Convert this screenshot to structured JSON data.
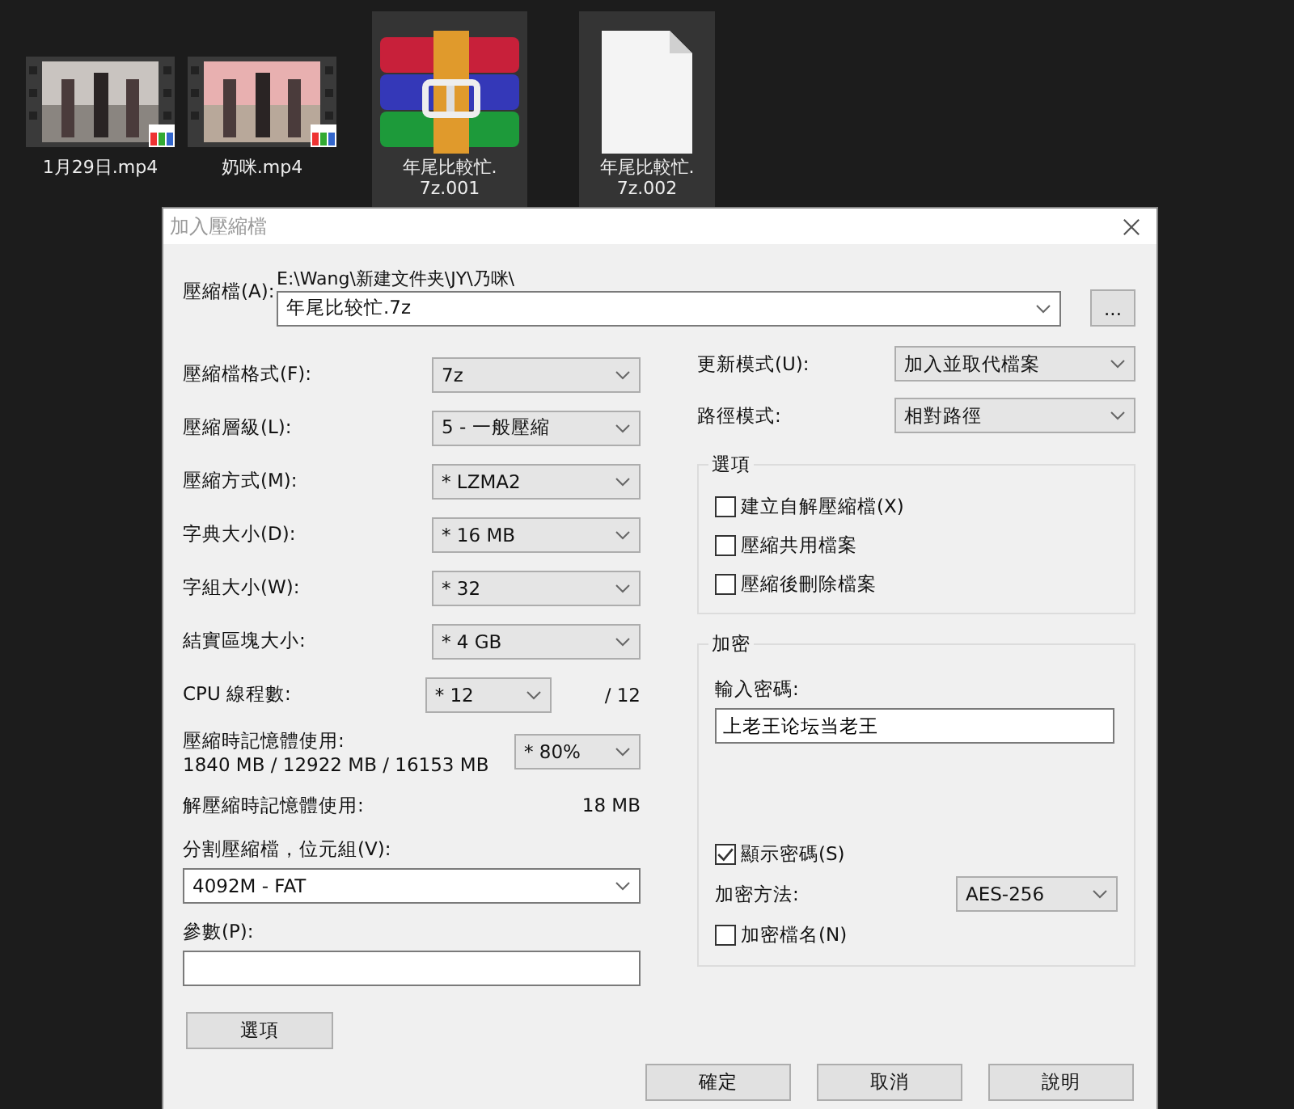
{
  "desktop": {
    "icons": [
      {
        "kind": "video",
        "label_lines": [
          "1月29日.mp4"
        ],
        "selected": false
      },
      {
        "kind": "video",
        "label_lines": [
          "奶咪.mp4"
        ],
        "selected": false
      },
      {
        "kind": "archive",
        "label_lines": [
          "年尾比較忙.",
          "7z.001"
        ],
        "selected": true
      },
      {
        "kind": "file",
        "label_lines": [
          "年尾比較忙.",
          "7z.002"
        ],
        "selected": true
      }
    ]
  },
  "dialog": {
    "title": "加入壓縮檔",
    "archive": {
      "label": "壓縮檔(A):",
      "path": "E:\\Wang\\新建文件夹\\JY\\乃咪\\",
      "value": "年尾比较忙.7z",
      "browse_button": "..."
    },
    "combos": [
      {
        "label": "壓縮檔格式(F):",
        "value": "7z"
      },
      {
        "label": "壓縮層級(L):",
        "value": "5 - 一般壓縮"
      },
      {
        "label": "壓縮方式(M):",
        "value": "* LZMA2"
      },
      {
        "label": "字典大小(D):",
        "value": "* 16 MB"
      },
      {
        "label": "字組大小(W):",
        "value": "* 32"
      },
      {
        "label": "結實區塊大小:",
        "value": "* 4 GB"
      }
    ],
    "cpu": {
      "label": "CPU 線程數:",
      "value": "* 12",
      "max": "/ 12"
    },
    "memory": {
      "label": "壓縮時記憶體使用:",
      "detail": "1840 MB / 12922 MB / 16153 MB",
      "value": "* 80%"
    },
    "decompress": {
      "label": "解壓縮時記憶體使用:",
      "value": "18 MB"
    },
    "split": {
      "label": "分割壓縮檔，位元組(V):",
      "value": "4092M - FAT"
    },
    "params": {
      "label": "參數(P):"
    },
    "options_button": "選項",
    "update_mode": {
      "label": "更新模式(U):",
      "value": "加入並取代檔案"
    },
    "path_mode": {
      "label": "路徑模式:",
      "value": "相對路徑"
    },
    "options_group": {
      "title": "選項",
      "items": [
        {
          "label": "建立自解壓縮檔(X)",
          "checked": false
        },
        {
          "label": "壓縮共用檔案",
          "checked": false
        },
        {
          "label": "壓縮後刪除檔案",
          "checked": false
        }
      ]
    },
    "encryption": {
      "title": "加密",
      "password_label": "輸入密碼:",
      "password": "上老王论坛当老王",
      "show_password": {
        "label": "顯示密碼(S)",
        "checked": true
      },
      "method": {
        "label": "加密方法:",
        "value": "AES-256"
      },
      "encrypt_names": {
        "label": "加密檔名(N)",
        "checked": false
      }
    },
    "buttons": [
      "確定",
      "取消",
      "說明"
    ]
  }
}
